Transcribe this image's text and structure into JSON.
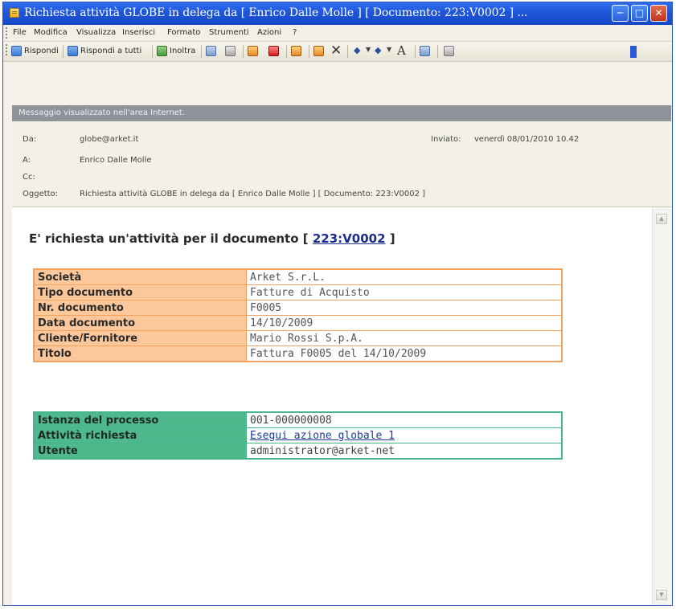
{
  "window": {
    "title": "Richiesta attività GLOBE in delega da [ Enrico Dalle Molle ] [ Documento: 223:V0002 ] ...",
    "controls": [
      "minimize-icon",
      "maximize-icon",
      "close-icon"
    ]
  },
  "menu": [
    "File",
    "Modifica",
    "Visualizza",
    "Inserisci",
    "Formato",
    "Strumenti",
    "Azioni",
    "?"
  ],
  "toolbar": {
    "reply_label": "Rispondi",
    "reply_all_label": "Rispondi a tutti",
    "forward_label": "Inoltra",
    "icons": [
      "print-icon",
      "move-icon",
      "flag-icon",
      "categories-icon",
      "follow-up-icon",
      "mark-unread-icon",
      "delete-icon",
      "previous-icon",
      "next-icon",
      "font-size-icon",
      "address-book-icon",
      "help-icon"
    ],
    "font_glyph": "A"
  },
  "infobar": "Messaggio visualizzato nell'area Internet.",
  "header": {
    "from_label": "Da:",
    "from_value": "globe@arket.it",
    "to_label": "A:",
    "to_value": "Enrico Dalle Molle",
    "cc_label": "Cc:",
    "cc_value": "",
    "subject_label": "Oggetto:",
    "subject_value": "Richiesta attività GLOBE in delega da [ Enrico Dalle Molle ] [ Documento: 223:V0002 ]",
    "sent_label": "Inviato:",
    "sent_value": "venerdì 08/01/2010 10.42"
  },
  "body": {
    "intro": "E' richiesta un'attività per il documento",
    "open_bracket": "[",
    "doc_link": "223:V0002",
    "close_bracket": "]",
    "document_table": [
      {
        "label": "Società",
        "value": "Arket S.r.L."
      },
      {
        "label": "Tipo documento",
        "value": "Fatture di Acquisto"
      },
      {
        "label": "Nr. documento",
        "value": "F0005"
      },
      {
        "label": "Data documento",
        "value": "14/10/2009"
      },
      {
        "label": "Cliente/Fornitore",
        "value": "Mario Rossi S.p.A."
      },
      {
        "label": "Titolo",
        "value": "Fattura F0005 del 14/10/2009"
      }
    ],
    "process_table": [
      {
        "label": "Istanza del processo",
        "value": "001-000000008"
      },
      {
        "label": "Attività richiesta",
        "value": "Esegui azione globale 1"
      },
      {
        "label": "Utente",
        "value": "administrator@arket-net"
      }
    ]
  },
  "colors": {
    "titlebar": "#1f56d8",
    "doc_table_label_bg": "#fcc79b",
    "doc_table_border": "#f4a15f",
    "process_table_label_bg": "#4fb88d",
    "process_table_border": "#43b68b",
    "infobar_bg": "#8f9399"
  }
}
